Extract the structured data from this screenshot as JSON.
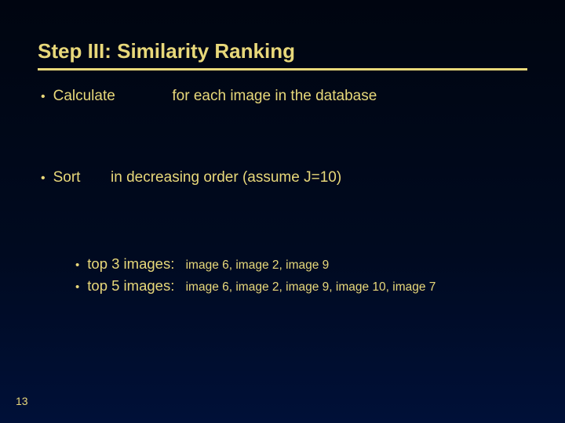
{
  "title": "Step III: Similarity Ranking",
  "bullet_calc_pre": "Calculate",
  "bullet_calc_post": "for each image in the database",
  "bullet_sort_pre": "Sort",
  "bullet_sort_post": "in decreasing order (assume J=10)",
  "sub": {
    "top3_label": "top 3 images:  ",
    "top3_list": "image 6, image 2, image 9",
    "top5_label": "top 5 images:  ",
    "top5_list": "image 6, image 2, image 9, image 10, image 7"
  },
  "page_number": "13"
}
